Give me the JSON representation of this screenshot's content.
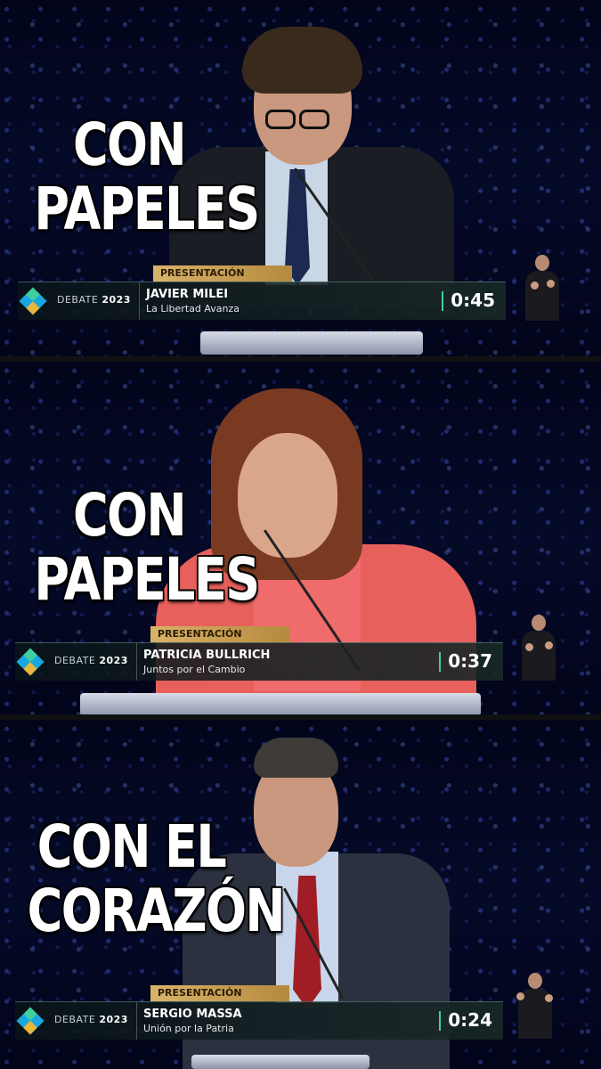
{
  "panels": [
    {
      "caption_lines": [
        "CON",
        "PAPELES"
      ],
      "tag": "PRESENTACIÓN",
      "debate_label": "DEBATE",
      "debate_year": "2023",
      "name": "JAVIER MILEI",
      "party": "La Libertad Avanza",
      "timer": "0:45"
    },
    {
      "caption_lines": [
        "CON",
        "PAPELES"
      ],
      "tag": "PRESENTACIÓN",
      "debate_label": "DEBATE",
      "debate_year": "2023",
      "name": "PATRICIA BULLRICH",
      "party": "Juntos por el Cambio",
      "timer": "0:37"
    },
    {
      "caption_lines": [
        "CON EL",
        "CORAZÓN"
      ],
      "tag": "PRESENTACIÓN",
      "debate_label": "DEBATE",
      "debate_year": "2023",
      "name": "SERGIO MASSA",
      "party": "Unión por la Patria",
      "timer": "0:24"
    }
  ],
  "colors": {
    "background": "#02051a",
    "tag_gold": "#d8b36a",
    "timer_accent": "#3fcf9c",
    "bullrich_jacket": "#e8605c"
  }
}
